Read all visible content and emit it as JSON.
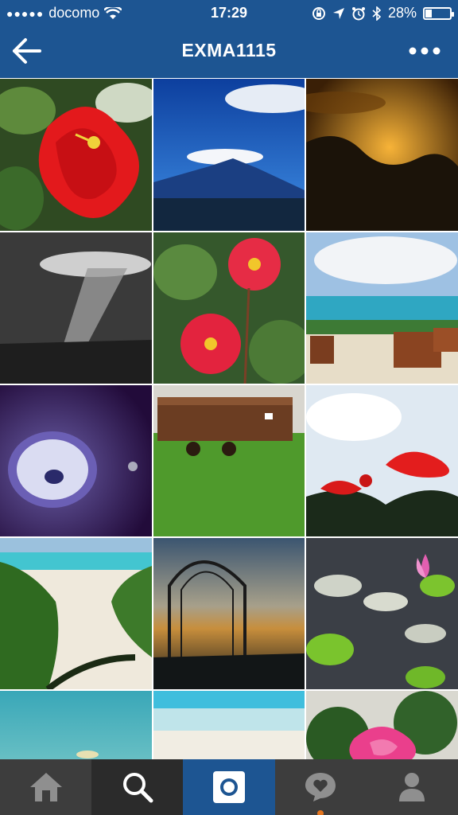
{
  "status_bar": {
    "carrier": "docomo",
    "time": "17:29",
    "battery": "28%",
    "battery_level": 0.28
  },
  "nav": {
    "title": "EXMA1115"
  },
  "grid": {
    "tiles": [
      {
        "subject": "red hibiscus flower"
      },
      {
        "subject": "mountain with lenticular cloud"
      },
      {
        "subject": "golden sunset clouds"
      },
      {
        "subject": "black and white sun rays"
      },
      {
        "subject": "red dahlia flowers"
      },
      {
        "subject": "ocean terrace with chairs"
      },
      {
        "subject": "purple circular light"
      },
      {
        "subject": "rusty mine cart on grass"
      },
      {
        "subject": "red flowers against sky"
      },
      {
        "subject": "beach path"
      },
      {
        "subject": "iron arch at dusk"
      },
      {
        "subject": "lotus pond"
      },
      {
        "subject": "teal sea horizon"
      },
      {
        "subject": "white sand beach"
      },
      {
        "subject": "pink hibiscus"
      }
    ]
  },
  "tabbar": {
    "items": [
      {
        "icon": "home-icon"
      },
      {
        "icon": "search-icon"
      },
      {
        "icon": "camera-icon"
      },
      {
        "icon": "activity-icon"
      },
      {
        "icon": "profile-icon"
      }
    ],
    "active_index": 2,
    "badge_color": "#e5751e"
  },
  "colors": {
    "header": "#1d5592",
    "tabbar": "#3d3d3d"
  }
}
